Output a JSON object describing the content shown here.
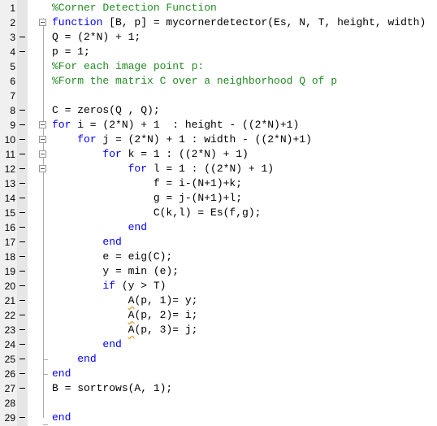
{
  "editor": {
    "colors": {
      "keyword": "#0000ff",
      "comment": "#228b22",
      "text": "#000000",
      "warning_underline": "#e8a030"
    },
    "lines": [
      {
        "n": "1",
        "dash": false,
        "fold": false,
        "tokens": [
          {
            "t": "%Corner Detection Function",
            "c": "cm"
          }
        ]
      },
      {
        "n": "2",
        "dash": false,
        "fold": true,
        "tokens": [
          {
            "t": "function",
            "c": "kw"
          },
          {
            "t": " [B, p] = mycornerdetector(Es, N, T, height, width)",
            "c": "tx"
          }
        ]
      },
      {
        "n": "3",
        "dash": true,
        "fold": false,
        "tokens": [
          {
            "t": "Q = (2*N) + 1;",
            "c": "tx"
          }
        ]
      },
      {
        "n": "4",
        "dash": true,
        "fold": false,
        "tokens": [
          {
            "t": "p = 1;",
            "c": "tx"
          }
        ]
      },
      {
        "n": "5",
        "dash": false,
        "fold": false,
        "tokens": [
          {
            "t": "%For each image point p:",
            "c": "cm"
          }
        ]
      },
      {
        "n": "6",
        "dash": false,
        "fold": false,
        "tokens": [
          {
            "t": "%Form the matrix C over a neighborhood Q of p",
            "c": "cm"
          }
        ]
      },
      {
        "n": "7",
        "dash": false,
        "fold": false,
        "tokens": []
      },
      {
        "n": "8",
        "dash": true,
        "fold": false,
        "tokens": [
          {
            "t": "C = zeros(Q , Q);",
            "c": "tx"
          }
        ]
      },
      {
        "n": "9",
        "dash": true,
        "fold": true,
        "tokens": [
          {
            "t": "for",
            "c": "kw"
          },
          {
            "t": " i = (2*N) + 1  : height - ((2*N)+1)",
            "c": "tx"
          }
        ]
      },
      {
        "n": "10",
        "dash": true,
        "fold": true,
        "tokens": [
          {
            "t": "    ",
            "c": "tx"
          },
          {
            "t": "for",
            "c": "kw"
          },
          {
            "t": " j = (2*N) + 1 : width - ((2*N)+1)",
            "c": "tx"
          }
        ]
      },
      {
        "n": "11",
        "dash": true,
        "fold": true,
        "tokens": [
          {
            "t": "        ",
            "c": "tx"
          },
          {
            "t": "for",
            "c": "kw"
          },
          {
            "t": " k = 1 : ((2*N) + 1)",
            "c": "tx"
          }
        ]
      },
      {
        "n": "12",
        "dash": true,
        "fold": true,
        "tokens": [
          {
            "t": "            ",
            "c": "tx"
          },
          {
            "t": "for",
            "c": "kw"
          },
          {
            "t": " l = 1 : ((2*N) + 1)",
            "c": "tx"
          }
        ]
      },
      {
        "n": "13",
        "dash": true,
        "fold": false,
        "tokens": [
          {
            "t": "                f = i-(N+1)+k;",
            "c": "tx"
          }
        ]
      },
      {
        "n": "14",
        "dash": true,
        "fold": false,
        "tokens": [
          {
            "t": "                g = j-(N+1)+l;",
            "c": "tx"
          }
        ]
      },
      {
        "n": "15",
        "dash": true,
        "fold": false,
        "tokens": [
          {
            "t": "                C(k,l) = Es(f,g);",
            "c": "tx"
          }
        ]
      },
      {
        "n": "16",
        "dash": true,
        "fold": false,
        "tokens": [
          {
            "t": "            ",
            "c": "tx"
          },
          {
            "t": "end",
            "c": "kw"
          }
        ]
      },
      {
        "n": "17",
        "dash": true,
        "fold": false,
        "tokens": [
          {
            "t": "        ",
            "c": "tx"
          },
          {
            "t": "end",
            "c": "kw"
          }
        ]
      },
      {
        "n": "18",
        "dash": true,
        "fold": false,
        "tokens": [
          {
            "t": "        e = eig(C);",
            "c": "tx"
          }
        ]
      },
      {
        "n": "19",
        "dash": true,
        "fold": false,
        "tokens": [
          {
            "t": "        y = min (e);",
            "c": "tx"
          }
        ]
      },
      {
        "n": "20",
        "dash": true,
        "fold": false,
        "tokens": [
          {
            "t": "        ",
            "c": "tx"
          },
          {
            "t": "if",
            "c": "kw"
          },
          {
            "t": " (y > T)",
            "c": "tx"
          }
        ]
      },
      {
        "n": "21",
        "dash": true,
        "fold": false,
        "tokens": [
          {
            "t": "            ",
            "c": "tx"
          },
          {
            "t": "A",
            "c": "warn"
          },
          {
            "t": "(p, 1)= y;",
            "c": "tx"
          }
        ]
      },
      {
        "n": "22",
        "dash": true,
        "fold": false,
        "tokens": [
          {
            "t": "            ",
            "c": "tx"
          },
          {
            "t": "A",
            "c": "warn"
          },
          {
            "t": "(p, 2)= i;",
            "c": "tx"
          }
        ]
      },
      {
        "n": "23",
        "dash": true,
        "fold": false,
        "tokens": [
          {
            "t": "            ",
            "c": "tx"
          },
          {
            "t": "A",
            "c": "warn"
          },
          {
            "t": "(p, 3)= j;",
            "c": "tx"
          }
        ]
      },
      {
        "n": "24",
        "dash": true,
        "fold": false,
        "tokens": [
          {
            "t": "        ",
            "c": "tx"
          },
          {
            "t": "end",
            "c": "kw"
          }
        ]
      },
      {
        "n": "25",
        "dash": true,
        "fold": false,
        "tokens": [
          {
            "t": "    ",
            "c": "tx"
          },
          {
            "t": "end",
            "c": "kw"
          }
        ]
      },
      {
        "n": "26",
        "dash": true,
        "fold": false,
        "tokens": [
          {
            "t": "end",
            "c": "kw"
          }
        ]
      },
      {
        "n": "27",
        "dash": true,
        "fold": false,
        "tokens": [
          {
            "t": "B = sortrows(A, 1);",
            "c": "tx"
          }
        ]
      },
      {
        "n": "28",
        "dash": false,
        "fold": false,
        "tokens": []
      },
      {
        "n": "29",
        "dash": true,
        "fold": false,
        "tokens": [
          {
            "t": "end",
            "c": "kw"
          }
        ]
      }
    ]
  }
}
